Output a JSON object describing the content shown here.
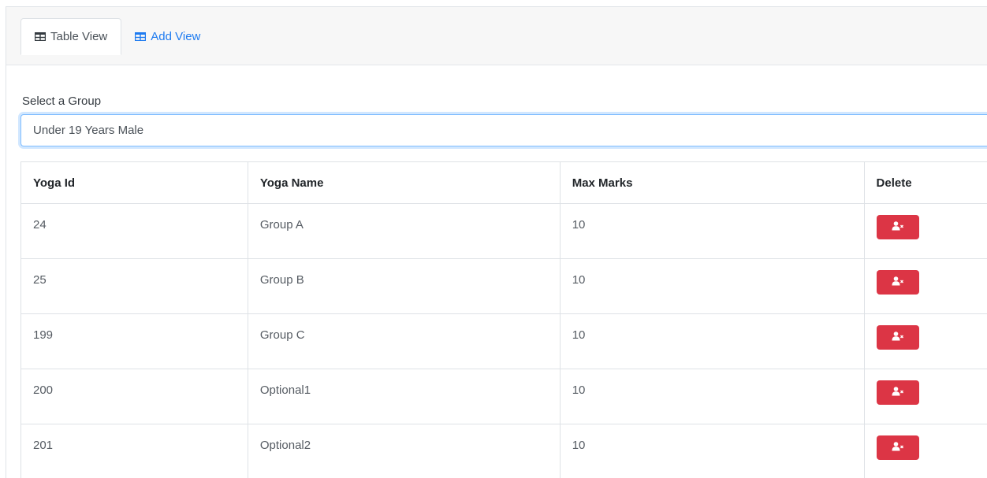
{
  "tabs": [
    {
      "label": "Table View",
      "icon": "table-icon"
    },
    {
      "label": "Add View",
      "icon": "table-icon"
    }
  ],
  "group_select": {
    "label": "Select a Group",
    "value": "Under 19 Years Male"
  },
  "table": {
    "headers": [
      "Yoga Id",
      "Yoga Name",
      "Max Marks",
      "Delete"
    ],
    "rows": [
      {
        "id": "24",
        "name": "Group A",
        "max_marks": "10"
      },
      {
        "id": "25",
        "name": "Group B",
        "max_marks": "10"
      },
      {
        "id": "199",
        "name": "Group C",
        "max_marks": "10"
      },
      {
        "id": "200",
        "name": "Optional1",
        "max_marks": "10"
      },
      {
        "id": "201",
        "name": "Optional2",
        "max_marks": "10"
      }
    ]
  },
  "colors": {
    "link": "#1e7bf0",
    "delete_button": "#dc3545",
    "focus_border": "#80bdff"
  },
  "icons": {
    "delete": "user-times-icon"
  }
}
